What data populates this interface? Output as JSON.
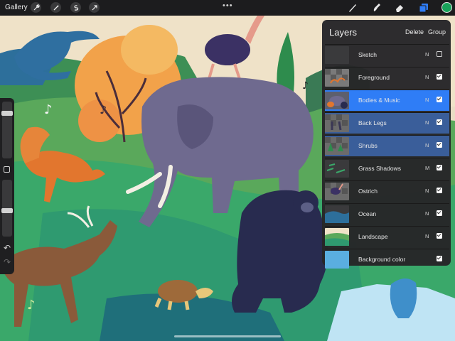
{
  "topbar": {
    "gallery_label": "Gallery",
    "left_tools": [
      "wrench-icon",
      "magic-wand-icon",
      "selection-icon",
      "transform-arrow-icon"
    ],
    "right_tools": [
      "brush-icon",
      "smudge-icon",
      "eraser-icon",
      "layers-icon"
    ],
    "more_label": "•••",
    "color_hex": "#18a35a"
  },
  "sidebar": {
    "brush_size_level": 0.18,
    "opacity_level": 0.55,
    "undo_label": "↶",
    "redo_label": "↷"
  },
  "layers_panel": {
    "title": "Layers",
    "delete_label": "Delete",
    "group_label": "Group",
    "layers": [
      {
        "name": "Sketch",
        "mode": "N",
        "visible": false,
        "state": "normal",
        "thumb": "blank"
      },
      {
        "name": "Foreground",
        "mode": "N",
        "visible": true,
        "state": "normal",
        "thumb": "foreground"
      },
      {
        "name": "Bodies & Music",
        "mode": "N",
        "visible": true,
        "state": "active",
        "thumb": "bodies"
      },
      {
        "name": "Back Legs",
        "mode": "N",
        "visible": true,
        "state": "selected",
        "thumb": "legs"
      },
      {
        "name": "Shrubs",
        "mode": "N",
        "visible": true,
        "state": "selected",
        "thumb": "shrubs"
      },
      {
        "name": "Grass Shadows",
        "mode": "M",
        "visible": true,
        "state": "normal",
        "thumb": "grass"
      },
      {
        "name": "Ostrich",
        "mode": "N",
        "visible": true,
        "state": "normal",
        "thumb": "ostrich"
      },
      {
        "name": "Ocean",
        "mode": "N",
        "visible": true,
        "state": "normal",
        "thumb": "ocean"
      },
      {
        "name": "Landscape",
        "mode": "N",
        "visible": true,
        "state": "normal",
        "thumb": "landscape"
      },
      {
        "name": "Background color",
        "mode": "",
        "visible": true,
        "state": "normal",
        "thumb": "bgcolor"
      }
    ]
  },
  "colors": {
    "accent_blue": "#2f7df6",
    "selected_blue": "#3a5e9a",
    "panel_bg": "#262628",
    "bg_color_swatch": "#5aaee0"
  }
}
